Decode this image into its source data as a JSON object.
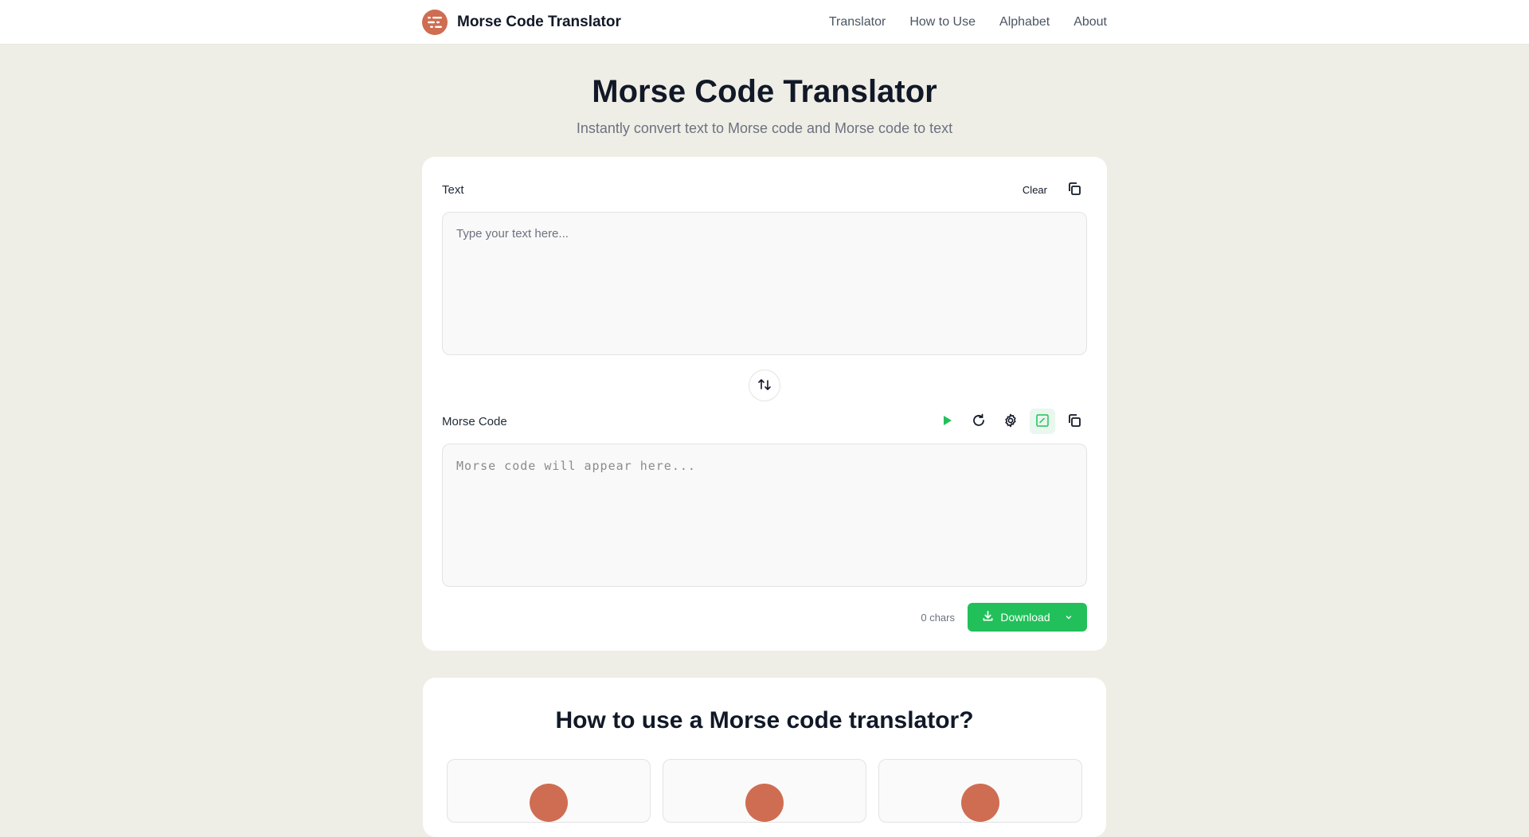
{
  "header": {
    "brand": "Morse Code Translator",
    "nav": [
      "Translator",
      "How to Use",
      "Alphabet",
      "About"
    ]
  },
  "hero": {
    "title": "Morse Code Translator",
    "subtitle": "Instantly convert text to Morse code and Morse code to text"
  },
  "text_section": {
    "label": "Text",
    "clear_label": "Clear",
    "placeholder": "Type your text here...",
    "value": ""
  },
  "morse_section": {
    "label": "Morse Code",
    "placeholder": "Morse code will appear here...",
    "value": ""
  },
  "footer": {
    "char_count": "0 chars",
    "download_label": "Download"
  },
  "how_to": {
    "title": "How to use a Morse code translator?"
  },
  "colors": {
    "accent": "#22c05a",
    "brand": "#cf6d52",
    "background": "#efeee6"
  },
  "icons": [
    "morse-logo-icon",
    "copy-icon",
    "swap-vertical-icon",
    "play-icon",
    "replay-icon",
    "gear-icon",
    "checkbox-icon",
    "download-icon",
    "chevron-down-icon"
  ]
}
